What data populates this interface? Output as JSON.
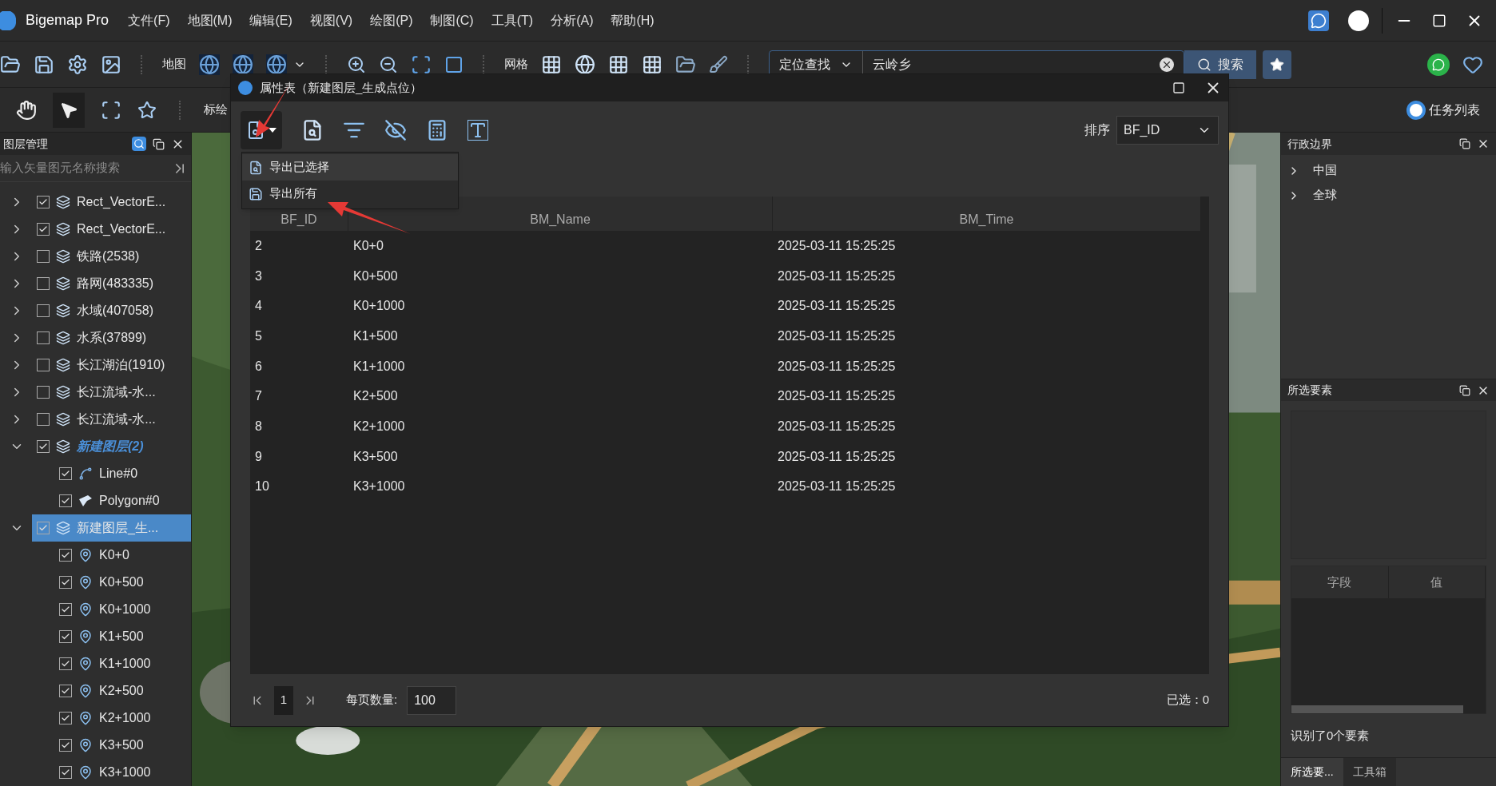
{
  "app": {
    "title": "Bigemap Pro",
    "menus": [
      "文件(F)",
      "地图(M)",
      "编辑(E)",
      "视图(V)",
      "绘图(P)",
      "制图(C)",
      "工具(T)",
      "分析(A)",
      "帮助(H)"
    ]
  },
  "toolbar": {
    "map_label": "地图",
    "grid_label": "网格",
    "search": {
      "mode": "定位查找",
      "value": "云岭乡",
      "button": "搜索"
    }
  },
  "toolbar2": {
    "label": "标绘",
    "task_list": "任务列表"
  },
  "layers_panel": {
    "title": "图层管理",
    "search_placeholder": "输入矢量图元名称搜索",
    "tree": [
      {
        "label": "Rect_VectorE...",
        "kind": "layer",
        "checked": true,
        "expanded": false,
        "selected": false,
        "highlighted": false
      },
      {
        "label": "Rect_VectorE...",
        "kind": "layer",
        "checked": true,
        "expanded": false,
        "selected": false,
        "highlighted": false
      },
      {
        "label": "铁路(2538)",
        "kind": "layer",
        "checked": false,
        "expanded": false,
        "selected": false,
        "highlighted": false
      },
      {
        "label": "路网(483335)",
        "kind": "layer",
        "checked": false,
        "expanded": false,
        "selected": false,
        "highlighted": false
      },
      {
        "label": "水域(407058)",
        "kind": "layer",
        "checked": false,
        "expanded": false,
        "selected": false,
        "highlighted": false
      },
      {
        "label": "水系(37899)",
        "kind": "layer",
        "checked": false,
        "expanded": false,
        "selected": false,
        "highlighted": false
      },
      {
        "label": "长江湖泊(1910)",
        "kind": "layer",
        "checked": false,
        "expanded": false,
        "selected": false,
        "highlighted": false
      },
      {
        "label": "长江流域-水...",
        "kind": "layer",
        "checked": false,
        "expanded": false,
        "selected": false,
        "highlighted": false
      },
      {
        "label": "长江流域-水...",
        "kind": "layer",
        "checked": false,
        "expanded": false,
        "selected": false,
        "highlighted": false
      },
      {
        "label": "新建图层(2)",
        "kind": "layer",
        "checked": true,
        "expanded": true,
        "selected": false,
        "highlighted": true,
        "children": [
          {
            "label": "Line#0",
            "kind": "line",
            "checked": true,
            "selected": false,
            "highlighted": false
          },
          {
            "label": "Polygon#0",
            "kind": "polygon",
            "checked": true,
            "selected": false,
            "highlighted": false
          }
        ]
      },
      {
        "label": "新建图层_生...",
        "kind": "layer",
        "checked": true,
        "expanded": true,
        "selected": true,
        "highlighted": false,
        "children": [
          {
            "label": "K0+0",
            "kind": "point",
            "checked": true,
            "selected": false,
            "highlighted": false
          },
          {
            "label": "K0+500",
            "kind": "point",
            "checked": true,
            "selected": false,
            "highlighted": false
          },
          {
            "label": "K0+1000",
            "kind": "point",
            "checked": true,
            "selected": false,
            "highlighted": false
          },
          {
            "label": "K1+500",
            "kind": "point",
            "checked": true,
            "selected": false,
            "highlighted": false
          },
          {
            "label": "K1+1000",
            "kind": "point",
            "checked": true,
            "selected": false,
            "highlighted": false
          },
          {
            "label": "K2+500",
            "kind": "point",
            "checked": true,
            "selected": false,
            "highlighted": false
          },
          {
            "label": "K2+1000",
            "kind": "point",
            "checked": true,
            "selected": false,
            "highlighted": false
          },
          {
            "label": "K3+500",
            "kind": "point",
            "checked": true,
            "selected": false,
            "highlighted": false
          },
          {
            "label": "K3+1000",
            "kind": "point",
            "checked": true,
            "selected": false,
            "highlighted": false
          }
        ]
      }
    ]
  },
  "attribute_dialog": {
    "title": "属性表（新建图层_生成点位）",
    "sort_label": "排序",
    "sort_value": "BF_ID",
    "export_menu": [
      {
        "label": "导出已选择",
        "kind": "csv",
        "selected": true
      },
      {
        "label": "导出所有",
        "kind": "save",
        "selected": false
      }
    ],
    "table": {
      "columns": [
        "BF_ID",
        "BM_Name",
        "BM_Time"
      ],
      "rows": [
        [
          "2",
          "K0+0",
          "2025-03-11 15:25:25"
        ],
        [
          "3",
          "K0+500",
          "2025-03-11 15:25:25"
        ],
        [
          "4",
          "K0+1000",
          "2025-03-11 15:25:25"
        ],
        [
          "5",
          "K1+500",
          "2025-03-11 15:25:25"
        ],
        [
          "6",
          "K1+1000",
          "2025-03-11 15:25:25"
        ],
        [
          "7",
          "K2+500",
          "2025-03-11 15:25:25"
        ],
        [
          "8",
          "K2+1000",
          "2025-03-11 15:25:25"
        ],
        [
          "9",
          "K3+500",
          "2025-03-11 15:25:25"
        ],
        [
          "10",
          "K3+1000",
          "2025-03-11 15:25:25"
        ]
      ]
    },
    "pager": {
      "page": "1",
      "page_size_label": "每页数量:",
      "page_size": "100",
      "selected_count": "已选：0"
    }
  },
  "boundary_panel": {
    "title": "行政边界",
    "items": [
      {
        "label": "中国",
        "expanded": false
      },
      {
        "label": "全球",
        "expanded": false
      }
    ]
  },
  "selection_panel": {
    "title": "所选要素",
    "columns": [
      "字段",
      "值"
    ],
    "status": "识别了0个要素",
    "tabs": [
      {
        "label": "所选要...",
        "selected": true
      },
      {
        "label": "工具箱",
        "selected": false
      }
    ]
  }
}
